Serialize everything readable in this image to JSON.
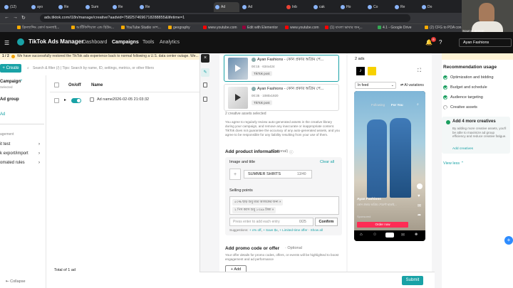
{
  "browser": {
    "tabs": [
      "(12)",
      "ayo",
      "Re",
      "Sum",
      "Re",
      "Re",
      "Ad",
      "Ad",
      "Inb",
      "cak",
      "Ho",
      "Co",
      "Re",
      "Do"
    ],
    "url": "ads.tiktok.com/i18n/manage/creative?aadvid=7582574696718288855&lifetime=1",
    "bookmarks": [
      "ফ্রিল্যান্সিং কোর্স অনলাই...",
      "আর্টিফিশিয়াল এন্ড হিউম...",
      "YouTube Studio ডাশ...",
      "geography",
      "www.youtube.com",
      "Edit with Elementor",
      "www.youtube.com",
      "(1) বাংলা ভাষার জন্...",
      "4.1 - Google Drive",
      "(2) CFG to PDA con..."
    ]
  },
  "webcam": {
    "label": "Source: person"
  },
  "header": {
    "logo": "TikTok Ads Manager",
    "nav": [
      "Dashboard",
      "Campaigns",
      "Tools",
      "Analytics"
    ],
    "account": "Ayan Fashions",
    "notifications": "6"
  },
  "banner": {
    "text": "We have successfully restored the TikTok ads experience back to normal following a U.S. data center outage. We..."
  },
  "left": {
    "pager": "1 / 2",
    "create": "Create",
    "search_placeholder": "Search & filter (/) | Tips: Search by name, ID, settings, metrics, or other filters",
    "campaign": "Campaign",
    "campaign_sub": "Selected",
    "ad_group": "Ad group",
    "ad": "Ad",
    "col_onoff": "On/off",
    "col_name": "Name",
    "row_name": "Ad name2026-02-05 21:03:32",
    "menu": [
      "agement",
      "it test",
      "k export/import",
      "omated rules"
    ],
    "total": "Total of 1 ad",
    "collapse": "Collapse"
  },
  "panel": {
    "assets": [
      {
        "title": "Ayan Fashions - কোন প্রকার অগ্রিম পে...",
        "meta": "00:15 · 634x424",
        "chip": "TikTok post"
      },
      {
        "title": "Ayan Fashions - কোন প্রকার অগ্রিম পে...",
        "meta": "00:35 · 1080x1920",
        "chip": "TikTok post"
      }
    ],
    "selected_count": "2 creative assets selected",
    "disclaimer": "You agree to regularly review auto-generated assets in the creative library during your campaign, and remove any inaccurate or inappropriate content. TikTok does not guarantee the accuracy of any auto-generated assets, and you agree to be responsible for any liability resulting from your use of them.",
    "product_info_title": "Add product information",
    "optional": "(Optional)",
    "image_title_label": "Image and title",
    "clear_all": "Clear all",
    "title_value": "SUMMER SHIRTS",
    "title_count": "13/40",
    "selling_points_label": "Selling points",
    "sp1": "৫০% ছাড় শুধু মাত্র আজকের জন্য",
    "sp2": "২ পিস ক্যাস শুধু ১৩৯৯ টাকা",
    "sp_placeholder": "Press enter to add each entry",
    "sp_count": "0/25",
    "confirm": "Confirm",
    "suggestions_label": "Suggestions:",
    "suggestions": [
      "+ x% off",
      "+ Save $x",
      "+ Limited-time offer"
    ],
    "show_all": "Show all",
    "promo_title": "Add promo code or offer",
    "promo_optional": "· Optional",
    "promo_desc": "Your offer details for promo codes, offers, or events will be highlighted to boost engagement and ad performance",
    "add": "Add",
    "submit": "Submit"
  },
  "preview": {
    "ads_count": "2 ads",
    "placement": "In feed",
    "variations": "AI variations",
    "following": "Following",
    "for_you": "For You",
    "username": "Ayan Fashions",
    "caption": "কোন প্রকার অগ্রিম পেমেন্ট ছাড়াই...",
    "sponsored": "Sponsored",
    "cta": "Order now"
  },
  "recommendations": {
    "title": "Recommendation usage",
    "items": [
      "Optimization and bidding",
      "Budget and schedule",
      "Audience targeting",
      "Creative assets"
    ],
    "card_title": "Add 4 more creatives",
    "card_text": "By adding more creative assets, you'll be able to maximize ad group efficiency and reduce creative fatigue.",
    "card_link": "Add creatives",
    "view_less": "View less"
  }
}
